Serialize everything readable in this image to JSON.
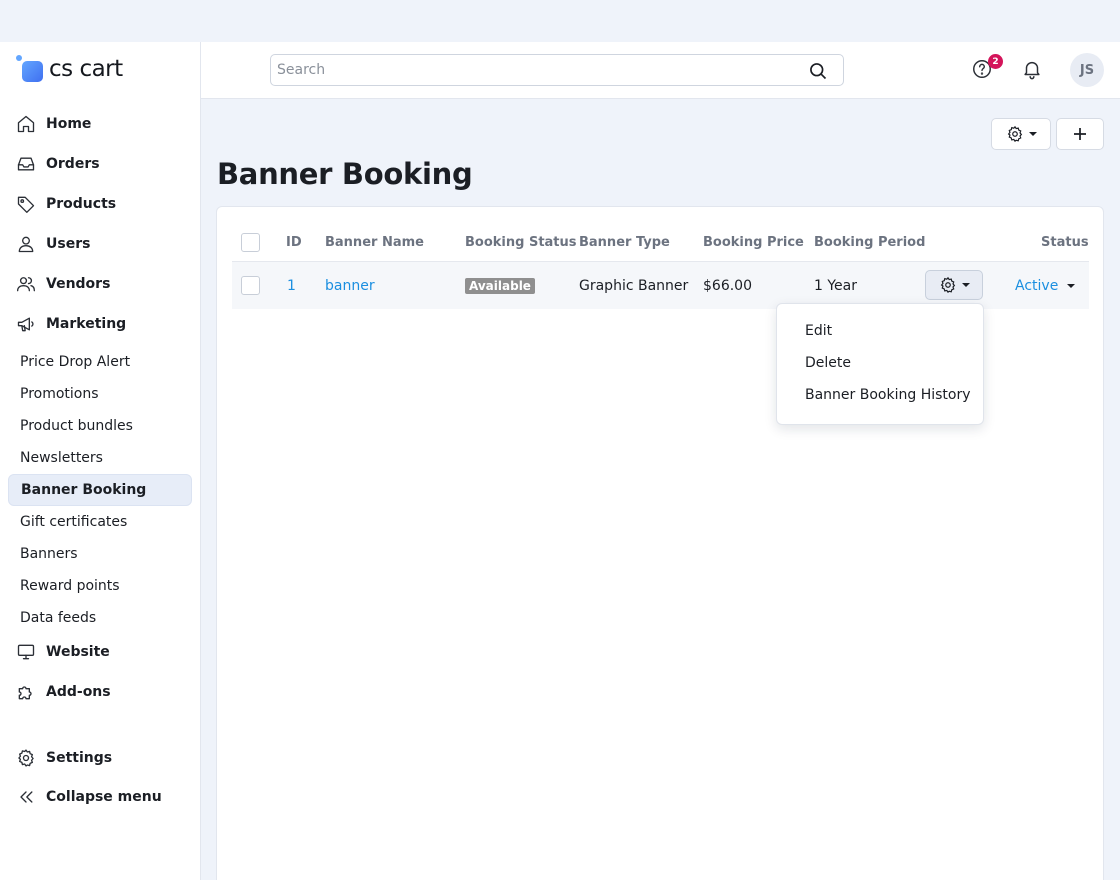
{
  "app": {
    "logo_text": "cs cart"
  },
  "sidebar": {
    "main_items": [
      {
        "label": "Home",
        "icon": "home-icon"
      },
      {
        "label": "Orders",
        "icon": "inbox-icon"
      },
      {
        "label": "Products",
        "icon": "tag-icon"
      },
      {
        "label": "Users",
        "icon": "user-icon"
      },
      {
        "label": "Vendors",
        "icon": "users-icon"
      },
      {
        "label": "Marketing",
        "icon": "megaphone-icon"
      }
    ],
    "marketing_items": [
      {
        "label": "Price Drop Alert"
      },
      {
        "label": "Promotions"
      },
      {
        "label": "Product bundles"
      },
      {
        "label": "Newsletters"
      },
      {
        "label": "Banner Booking",
        "active": true
      },
      {
        "label": "Gift certificates"
      },
      {
        "label": "Banners"
      },
      {
        "label": "Reward points"
      },
      {
        "label": "Data feeds"
      }
    ],
    "bottom_items": [
      {
        "label": "Website",
        "icon": "monitor-icon"
      },
      {
        "label": "Add-ons",
        "icon": "puzzle-icon"
      },
      {
        "label": "Settings",
        "icon": "gear-icon"
      },
      {
        "label": "Collapse menu",
        "icon": "double-chevron-left-icon"
      }
    ]
  },
  "header": {
    "search_placeholder": "Search",
    "help_badge": "2",
    "avatar_initials": "JS"
  },
  "page": {
    "title": "Banner Booking"
  },
  "table": {
    "columns": [
      "ID",
      "Banner Name",
      "Booking Status",
      "Banner Type",
      "Booking Price",
      "Booking Period",
      "Status"
    ],
    "rows": [
      {
        "id": "1",
        "banner_name": "banner",
        "booking_status": "Available",
        "banner_type": "Graphic Banner",
        "booking_price": "$66.00",
        "booking_period": "1 Year",
        "status": "Active"
      }
    ]
  },
  "row_menu": {
    "items": [
      "Edit",
      "Delete",
      "Banner Booking History"
    ]
  },
  "colors": {
    "link": "#1b8fe0",
    "badge": "#d4145a",
    "accent": "#3f6ff0"
  }
}
